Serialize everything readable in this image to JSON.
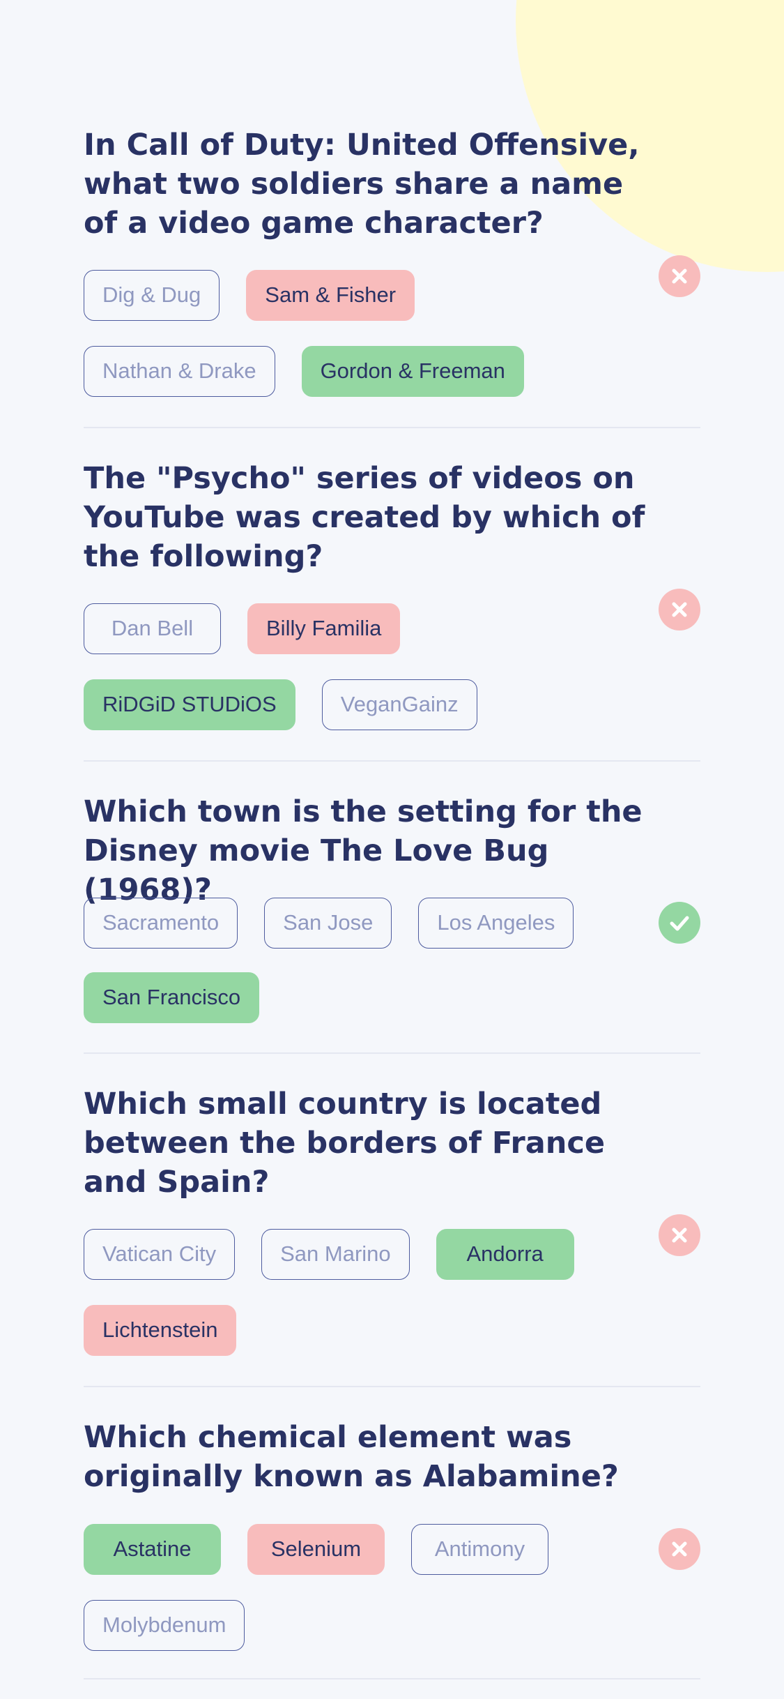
{
  "questions": [
    {
      "text": "In Call of Duty: United Offensive, what two soldiers share a name of a video game character?",
      "answers": [
        {
          "label": "Dig & Dug",
          "state": "neutral"
        },
        {
          "label": "Sam & Fisher",
          "state": "wrong"
        },
        {
          "label": "Nathan & Drake",
          "state": "neutral"
        },
        {
          "label": "Gordon & Freeman",
          "state": "correct"
        }
      ],
      "result": "incorrect",
      "result_icon": "close-icon"
    },
    {
      "text": "The \"Psycho\" series of videos on YouTube was created by which of the following?",
      "answers": [
        {
          "label": "Dan Bell",
          "state": "neutral"
        },
        {
          "label": "Billy Familia",
          "state": "wrong"
        },
        {
          "label": "RiDGiD STUDiOS",
          "state": "correct"
        },
        {
          "label": "VeganGainz",
          "state": "neutral"
        }
      ],
      "result": "incorrect",
      "result_icon": "close-icon"
    },
    {
      "text": "Which town is the setting for the Disney movie The Love Bug (1968)?",
      "answers": [
        {
          "label": "Sacramento",
          "state": "neutral"
        },
        {
          "label": "San Jose",
          "state": "neutral"
        },
        {
          "label": "Los Angeles",
          "state": "neutral"
        },
        {
          "label": "San Francisco",
          "state": "correct"
        }
      ],
      "result": "correct",
      "result_icon": "check-icon"
    },
    {
      "text": "Which small country is located between the borders of France and Spain?",
      "answers": [
        {
          "label": "Vatican City",
          "state": "neutral"
        },
        {
          "label": "San Marino",
          "state": "neutral"
        },
        {
          "label": "Andorra",
          "state": "correct"
        },
        {
          "label": "Lichtenstein",
          "state": "wrong"
        }
      ],
      "result": "incorrect",
      "result_icon": "close-icon"
    },
    {
      "text": "Which chemical element was originally known as Alabamine?",
      "answers": [
        {
          "label": "Astatine",
          "state": "correct"
        },
        {
          "label": "Selenium",
          "state": "wrong"
        },
        {
          "label": "Antimony",
          "state": "neutral"
        },
        {
          "label": "Molybdenum",
          "state": "neutral"
        }
      ],
      "result": "incorrect",
      "result_icon": "close-icon"
    }
  ],
  "colors": {
    "background": "#f5f7fb",
    "text": "#293264",
    "correct": "#94d7a2",
    "wrong": "#f8bcbc",
    "neutral_text": "#8f98c0",
    "outline": "#4d5b9e",
    "blob": "#fffad1"
  }
}
